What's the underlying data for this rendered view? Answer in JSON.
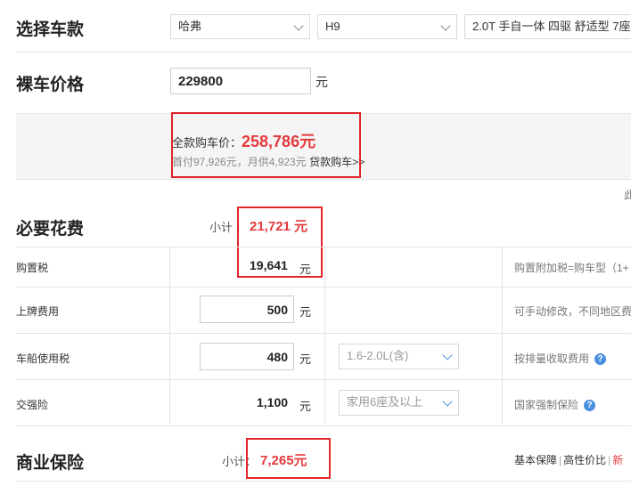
{
  "select_car": {
    "title": "选择车款",
    "brand": "哈弗",
    "model": "H9",
    "trim": "2.0T 手自一体 四驱 舒适型 7座"
  },
  "bare_price": {
    "title": "裸车价格",
    "value": "229800",
    "unit": "元"
  },
  "full_price": {
    "label": "全款购车价：",
    "value": "258,786元",
    "sub": "首付97,926元，月供4,923元",
    "loan_link": "贷款购车>>",
    "side_char": "此"
  },
  "required": {
    "title": "必要花费",
    "subtotal_label": "小计",
    "subtotal_value": "21,721 元",
    "rows": [
      {
        "label": "购置税",
        "value": "19,641",
        "unit": "元",
        "note": "购置附加税=购车型（1+"
      },
      {
        "label": "上牌费用",
        "value": "500",
        "unit": "元",
        "note": "可手动修改，不同地区费"
      },
      {
        "label": "车船使用税",
        "value": "480",
        "unit": "元",
        "select": "1.6-2.0L(含)",
        "note": "按排量收取费用"
      },
      {
        "label": "交强险",
        "value": "1,100",
        "unit": "元",
        "select": "家用6座及以上",
        "note": "国家强制保险"
      }
    ]
  },
  "commercial": {
    "title": "商业保险",
    "subtotal_label": "小计：",
    "subtotal_value": "7,265元",
    "tabs": [
      "基本保障",
      "高性价比",
      "新"
    ]
  },
  "colors": {
    "accent_red": "#e4393c",
    "box_red": "#e0262b",
    "help_blue": "#4b8fe0"
  }
}
